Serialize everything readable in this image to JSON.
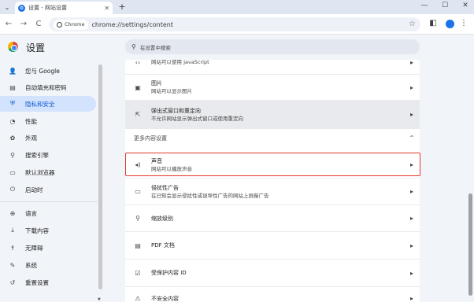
{
  "window": {
    "tab_title": "设置 - 网站设置",
    "new_tab": "+",
    "minimize": "—",
    "maximize": "☐",
    "close": "✕",
    "tab_close": "✕"
  },
  "toolbar": {
    "back": "←",
    "forward": "→",
    "reload": "C",
    "chip": "Chrome",
    "url": "chrome://settings/content",
    "star": "☆"
  },
  "header": {
    "title": "设置",
    "search_placeholder": "在设置中搜索"
  },
  "sidebar": {
    "items": [
      {
        "label": "您与 Google",
        "icon": "person-icon",
        "glyph": "👤"
      },
      {
        "label": "自动填充和密码",
        "icon": "autofill-icon",
        "glyph": "▤"
      },
      {
        "label": "隐私和安全",
        "icon": "shield-icon",
        "glyph": "⛨"
      },
      {
        "label": "性能",
        "icon": "performance-icon",
        "glyph": "◔"
      },
      {
        "label": "外观",
        "icon": "palette-icon",
        "glyph": "✿"
      },
      {
        "label": "搜索引擎",
        "icon": "search-icon",
        "glyph": "⚲"
      },
      {
        "label": "默认浏览器",
        "icon": "browser-icon",
        "glyph": "▭"
      },
      {
        "label": "启动时",
        "icon": "power-icon",
        "glyph": "⏻"
      },
      {
        "label": "语言",
        "icon": "globe-icon",
        "glyph": "⊕"
      },
      {
        "label": "下载内容",
        "icon": "download-icon",
        "glyph": "⤓"
      },
      {
        "label": "无障碍",
        "icon": "accessibility-icon",
        "glyph": "☨"
      },
      {
        "label": "系统",
        "icon": "wrench-icon",
        "glyph": "✎"
      },
      {
        "label": "重置设置",
        "icon": "reset-icon",
        "glyph": "↺"
      }
    ]
  },
  "content": {
    "rows": [
      {
        "title": "",
        "subtitle": "网站可以使用 JavaScript",
        "icon": "code-icon",
        "glyph": "‹›"
      },
      {
        "title": "图片",
        "subtitle": "网站可以显示图片",
        "icon": "image-icon",
        "glyph": "▣"
      },
      {
        "title": "弹出式窗口和重定向",
        "subtitle": "不允许网站显示弹出式窗口或使用重定向",
        "icon": "popup-icon",
        "glyph": "⇱"
      }
    ],
    "section_title": "更多内容设置",
    "more_rows": [
      {
        "title": "声音",
        "subtitle": "网站可以播放声音",
        "icon": "sound-icon",
        "glyph": "◂)"
      },
      {
        "title": "侵扰性广告",
        "subtitle": "在已知会显示侵扰性或误导性广告的网站上屏蔽广告",
        "icon": "ads-icon",
        "glyph": "▭"
      },
      {
        "title": "缩放级别",
        "subtitle": "",
        "icon": "zoom-icon",
        "glyph": "⚲"
      },
      {
        "title": "PDF 文档",
        "subtitle": "",
        "icon": "pdf-icon",
        "glyph": "▤"
      },
      {
        "title": "受保护内容 ID",
        "subtitle": "",
        "icon": "protected-content-icon",
        "glyph": "☑"
      },
      {
        "title": "不安全内容",
        "subtitle": "",
        "icon": "warning-icon",
        "glyph": "⚠"
      }
    ],
    "chevron": "▸",
    "collapse": "⌃"
  }
}
